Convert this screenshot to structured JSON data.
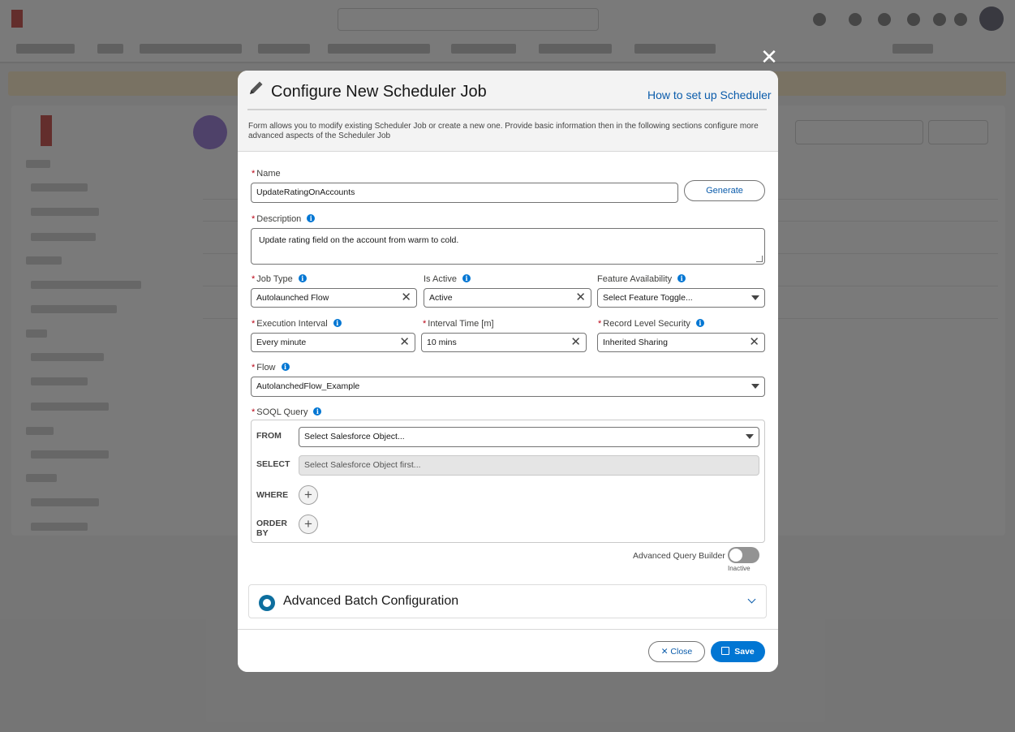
{
  "modal": {
    "title": "Configure New Scheduler Job",
    "help_link": "How to set up Scheduler",
    "description": "Form allows you to modify existing Scheduler Job or create a new one. Provide basic information then in the following sections configure more advanced aspects of the Scheduler Job",
    "close_icon": "close-icon"
  },
  "form": {
    "required_marker": "*",
    "name": {
      "label": "Name",
      "value": "UpdateRatingOnAccounts"
    },
    "generate_button": "Generate",
    "description": {
      "label": "Description",
      "value": "Update rating field on the account from warm to cold."
    },
    "job_type": {
      "label": "Job Type",
      "value": "Autolaunched Flow"
    },
    "is_active": {
      "label": "Is Active",
      "value": "Active"
    },
    "feature_availability": {
      "label": "Feature Availability",
      "placeholder": "Select Feature Toggle..."
    },
    "execution_interval": {
      "label": "Execution Interval",
      "value": "Every minute"
    },
    "interval_time": {
      "label": "Interval Time [m]",
      "value": "10 mins"
    },
    "record_level_security": {
      "label": "Record Level Security",
      "value": "Inherited Sharing"
    },
    "flow": {
      "label": "Flow",
      "value": "AutolanchedFlow_Example"
    },
    "soql": {
      "label": "SOQL Query",
      "from_label": "FROM",
      "from_placeholder": "Select Salesforce Object...",
      "select_label": "SELECT",
      "select_placeholder": "Select Salesforce Object first...",
      "where_label": "WHERE",
      "order_label_1": "ORDER",
      "order_label_2": "BY"
    },
    "advanced_query_builder": {
      "label": "Advanced Query Builder",
      "state": "Inactive"
    }
  },
  "accordion": {
    "title": "Advanced Batch Configuration"
  },
  "footer": {
    "close": "Close",
    "save": "Save"
  },
  "colors": {
    "brand": "#0176d3",
    "link": "#0b5cab",
    "required": "#ba0517"
  }
}
